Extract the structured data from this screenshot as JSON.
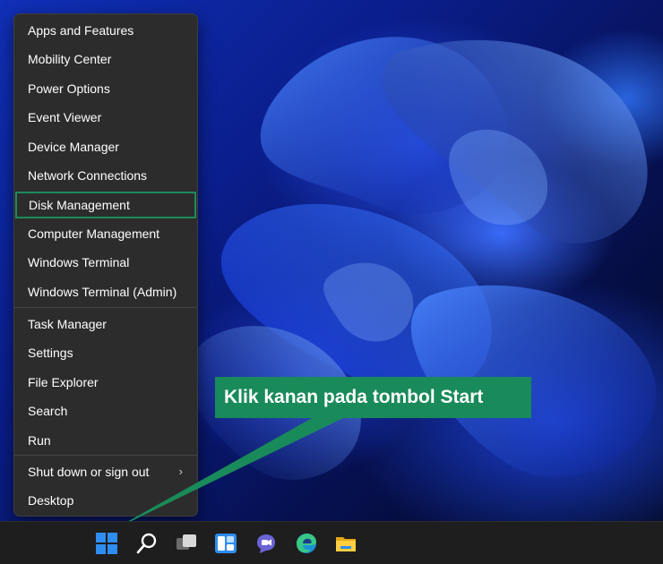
{
  "context_menu": {
    "items": [
      "Apps and Features",
      "Mobility Center",
      "Power Options",
      "Event Viewer",
      "Device Manager",
      "Network Connections",
      "Disk Management",
      "Computer Management",
      "Windows Terminal",
      "Windows Terminal (Admin)",
      "Task Manager",
      "Settings",
      "File Explorer",
      "Search",
      "Run",
      "Shut down or sign out",
      "Desktop"
    ],
    "highlighted_item": "Disk Management",
    "submenu_arrow": "›"
  },
  "callout": {
    "text": "Klik kanan pada tombol Start",
    "color": "#198a59"
  },
  "taskbar": {
    "icons": [
      "start-icon",
      "search-icon",
      "task-view-icon",
      "widgets-icon",
      "teams-chat-icon",
      "edge-icon",
      "file-explorer-icon"
    ]
  },
  "colors": {
    "menu_bg": "#2c2c2c",
    "highlight_border": "#1d8a5c",
    "accent_blue": "#1f78e6"
  }
}
